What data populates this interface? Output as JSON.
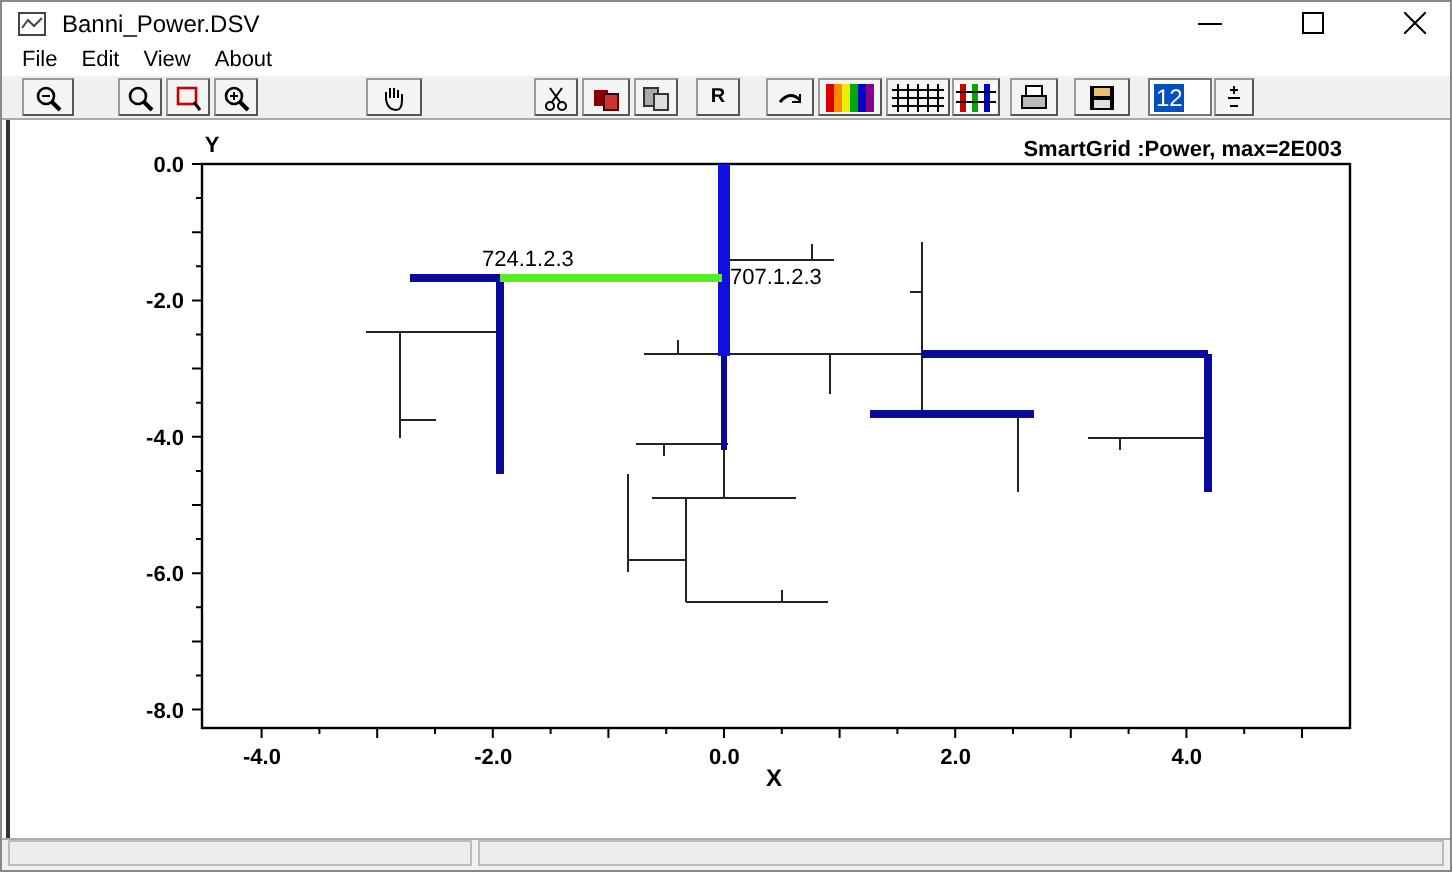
{
  "window": {
    "title": "Banni_Power.DSV"
  },
  "menu": [
    "File",
    "Edit",
    "View",
    "About"
  ],
  "toolbar": {
    "r_button": "R",
    "number_field": "12"
  },
  "plot": {
    "title": "SmartGrid :Power, max=2E003",
    "y_label": "Y",
    "x_label": "X",
    "y_ticks": [
      "0.0",
      "-2.0",
      "-4.0",
      "-6.0",
      "-8.0"
    ],
    "x_ticks": [
      "-4.0",
      "-2.0",
      "0.0",
      "2.0",
      "4.0"
    ],
    "node_labels": [
      "724.1.2.3",
      "707.1.2.3"
    ]
  }
}
